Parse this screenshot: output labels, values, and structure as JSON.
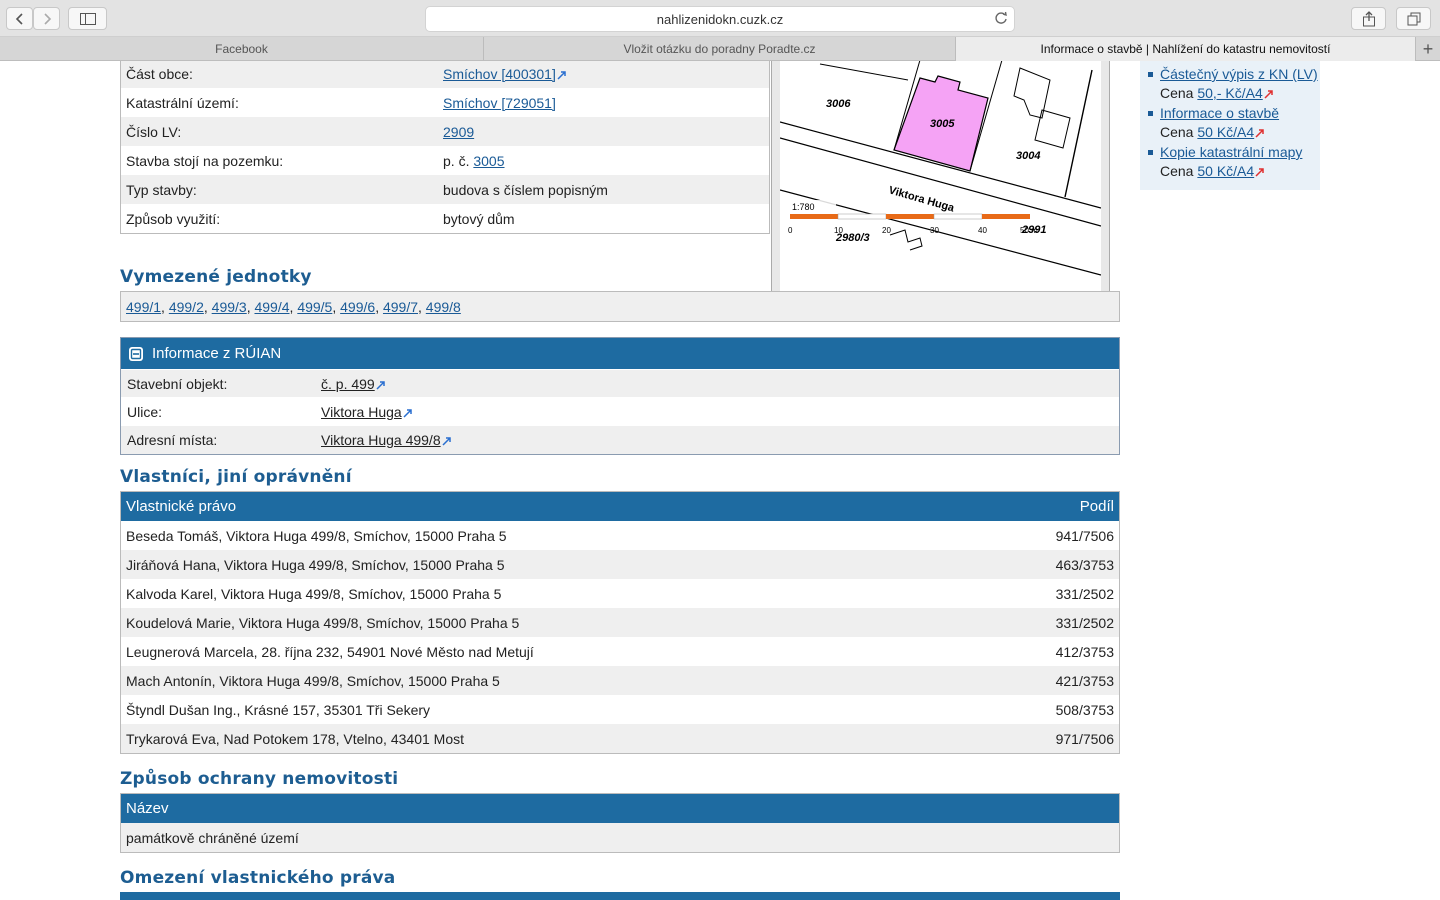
{
  "browser": {
    "url": "nahlizenidokn.cuzk.cz",
    "tabs": [
      {
        "label": "Facebook",
        "active": false
      },
      {
        "label": "Vložit otázku do poradny Poradte.cz",
        "active": false
      },
      {
        "label": "Informace o stavbě | Nahlížení do katastru nemovitostí",
        "active": true
      }
    ]
  },
  "info": {
    "cast_obce_label": "Část obce:",
    "cast_obce_value": "Smíchov [400301]",
    "ku_label": "Katastrální území:",
    "ku_value": "Smíchov [729051]",
    "lv_label": "Číslo LV:",
    "lv_value": "2909",
    "pozemek_label": "Stavba stojí na pozemku:",
    "pozemek_prefix": "p. č.",
    "pozemek_value": "3005",
    "typ_label": "Typ stavby:",
    "typ_value": "budova s číslem popisným",
    "vyuziti_label": "Způsob využití:",
    "vyuziti_value": "bytový dům"
  },
  "map": {
    "scale": "1:780",
    "street": "Viktora Huga",
    "parcels": [
      "3006",
      "3005",
      "3004",
      "2991",
      "2980/3"
    ],
    "scale_ticks": [
      "0",
      "10",
      "20",
      "30",
      "40",
      "50 m"
    ]
  },
  "sidebar": {
    "items": [
      {
        "link": "Částečný výpis z KN (LV)",
        "price_label": "Cena",
        "price": "50,- Kč/A4"
      },
      {
        "link": "Informace o stavbě",
        "price_label": "Cena",
        "price": "50 Kč/A4"
      },
      {
        "link": "Kopie katastrální mapy",
        "price_label": "Cena",
        "price": "50 Kč/A4"
      }
    ]
  },
  "units": {
    "title": "Vymezené jednotky",
    "items": [
      "499/1",
      "499/2",
      "499/3",
      "499/4",
      "499/5",
      "499/6",
      "499/7",
      "499/8"
    ]
  },
  "ruian": {
    "title": "Informace z RÚIAN",
    "rows": [
      {
        "label": "Stavební objekt:",
        "value": "č. p. 499"
      },
      {
        "label": "Ulice:",
        "value": "Viktora Huga"
      },
      {
        "label": "Adresní místa:",
        "value": "Viktora Huga 499/8"
      }
    ]
  },
  "owners": {
    "title": "Vlastníci, jiní oprávnění",
    "col_name": "Vlastnické právo",
    "col_share": "Podíl",
    "rows": [
      {
        "name": "Beseda Tomáš, Viktora Huga 499/8, Smíchov, 15000 Praha 5",
        "share": "941/7506"
      },
      {
        "name": "Jiráňová Hana, Viktora Huga 499/8, Smíchov, 15000 Praha 5",
        "share": "463/3753"
      },
      {
        "name": "Kalvoda Karel, Viktora Huga 499/8, Smíchov, 15000 Praha 5",
        "share": "331/2502"
      },
      {
        "name": "Koudelová Marie, Viktora Huga 499/8, Smíchov, 15000 Praha 5",
        "share": "331/2502"
      },
      {
        "name": "Leugnerová Marcela, 28. října 232, 54901 Nové Město nad Metují",
        "share": "412/3753"
      },
      {
        "name": "Mach Antonín, Viktora Huga 499/8, Smíchov, 15000 Praha 5",
        "share": "421/3753"
      },
      {
        "name": "Štyndl Dušan Ing., Krásné 157, 35301 Tři Sekery",
        "share": "508/3753"
      },
      {
        "name": "Trykarová Eva, Nad Potokem 178, Vtelno, 43401 Most",
        "share": "971/7506"
      }
    ]
  },
  "protection": {
    "title": "Způsob ochrany nemovitosti",
    "col_name": "Název",
    "rows": [
      {
        "name": "památkově chráněné území"
      }
    ]
  },
  "restrictions": {
    "title": "Omezení vlastnického práva"
  },
  "colors": {
    "header_blue": "#1e6ba1",
    "heading_blue": "#1d5d91",
    "link_blue": "#1a5a96",
    "parcel_highlight": "#f5a3f5"
  }
}
